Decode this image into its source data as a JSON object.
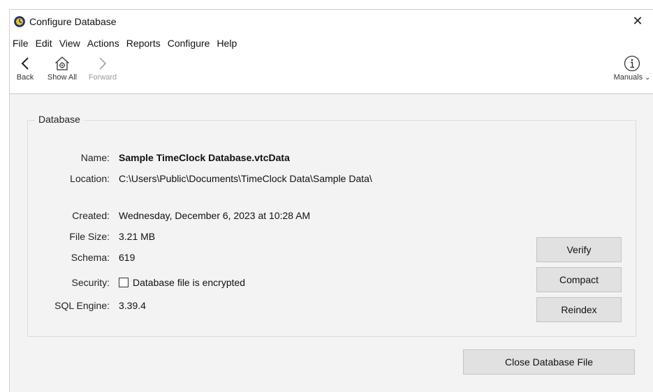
{
  "window": {
    "title": "Configure Database",
    "close_glyph": "✕"
  },
  "menu": [
    "File",
    "Edit",
    "View",
    "Actions",
    "Reports",
    "Configure",
    "Help"
  ],
  "toolbar": {
    "back_label": "Back",
    "show_all_label": "Show All",
    "forward_label": "Forward",
    "manuals_label": "Manuals"
  },
  "database": {
    "group_title": "Database",
    "name_label": "Name:",
    "name_value": "Sample TimeClock Database.vtcData",
    "location_label": "Location:",
    "location_value": "C:\\Users\\Public\\Documents\\TimeClock Data\\Sample Data\\",
    "created_label": "Created:",
    "created_value": "Wednesday, December 6, 2023 at 10:28 AM",
    "file_size_label": "File Size:",
    "file_size_value": "3.21 MB",
    "schema_label": "Schema:",
    "schema_value": "619",
    "security_label": "Security:",
    "encrypted_label": "Database file is encrypted",
    "encrypted_checked": false,
    "sql_engine_label": "SQL Engine:",
    "sql_engine_value": "3.39.4"
  },
  "buttons": {
    "verify": "Verify",
    "compact": "Compact",
    "reindex": "Reindex",
    "close_file": "Close Database File"
  },
  "colors": {
    "content_background": "#f3f3f3",
    "button_background": "#e1e1e1",
    "disabled_text": "#9a9a9a"
  }
}
